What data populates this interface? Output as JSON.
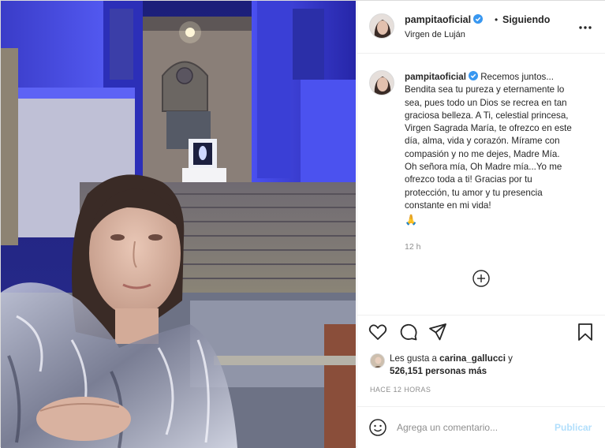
{
  "post": {
    "username": "pampitaoficial",
    "separator": "•",
    "follow_status": "Siguiendo",
    "location": "Virgen de Luján",
    "photo_alt": "Selfie frente a la Basílica iluminada de azul"
  },
  "caption": {
    "username": "pampitaoficial",
    "lines": [
      "Recemos juntos...",
      "Bendita sea tu pureza y eternamente lo",
      "sea, pues todo un Dios se recrea en tan",
      "graciosa belleza. A Ti, celestial princesa,",
      "Virgen Sagrada María, te ofrezco en este",
      "día, alma, vida y corazón. Mírame con",
      "compasión y no me dejes, Madre Mía.",
      "Oh señora mía, Oh Madre mía...Yo me",
      "ofrezco toda a ti! Gracias por tu",
      "protección, tu amor y tu presencia",
      "constante en mi vida!"
    ],
    "emoji": "🙏",
    "time": "12 h"
  },
  "likes": {
    "prefix": "Les gusta a ",
    "user": "carina_gallucci",
    "middle": " y",
    "count": "526,151 personas más"
  },
  "time_ago": "HACE 12 HORAS",
  "comment": {
    "placeholder": "Agrega un comentario...",
    "publish_label": "Publicar"
  },
  "colors": {
    "verified": "#3897f0",
    "publish_disabled": "#b2dffc",
    "secondary_text": "#8e8e8e",
    "border": "#dbdbdb"
  },
  "icons": {
    "more": "more-options-icon",
    "load_more": "plus-circle-icon",
    "like": "heart-icon",
    "comment": "comment-bubble-icon",
    "share": "paper-plane-icon",
    "save": "bookmark-icon",
    "emoji": "smiley-icon",
    "verified": "verified-badge-icon"
  }
}
